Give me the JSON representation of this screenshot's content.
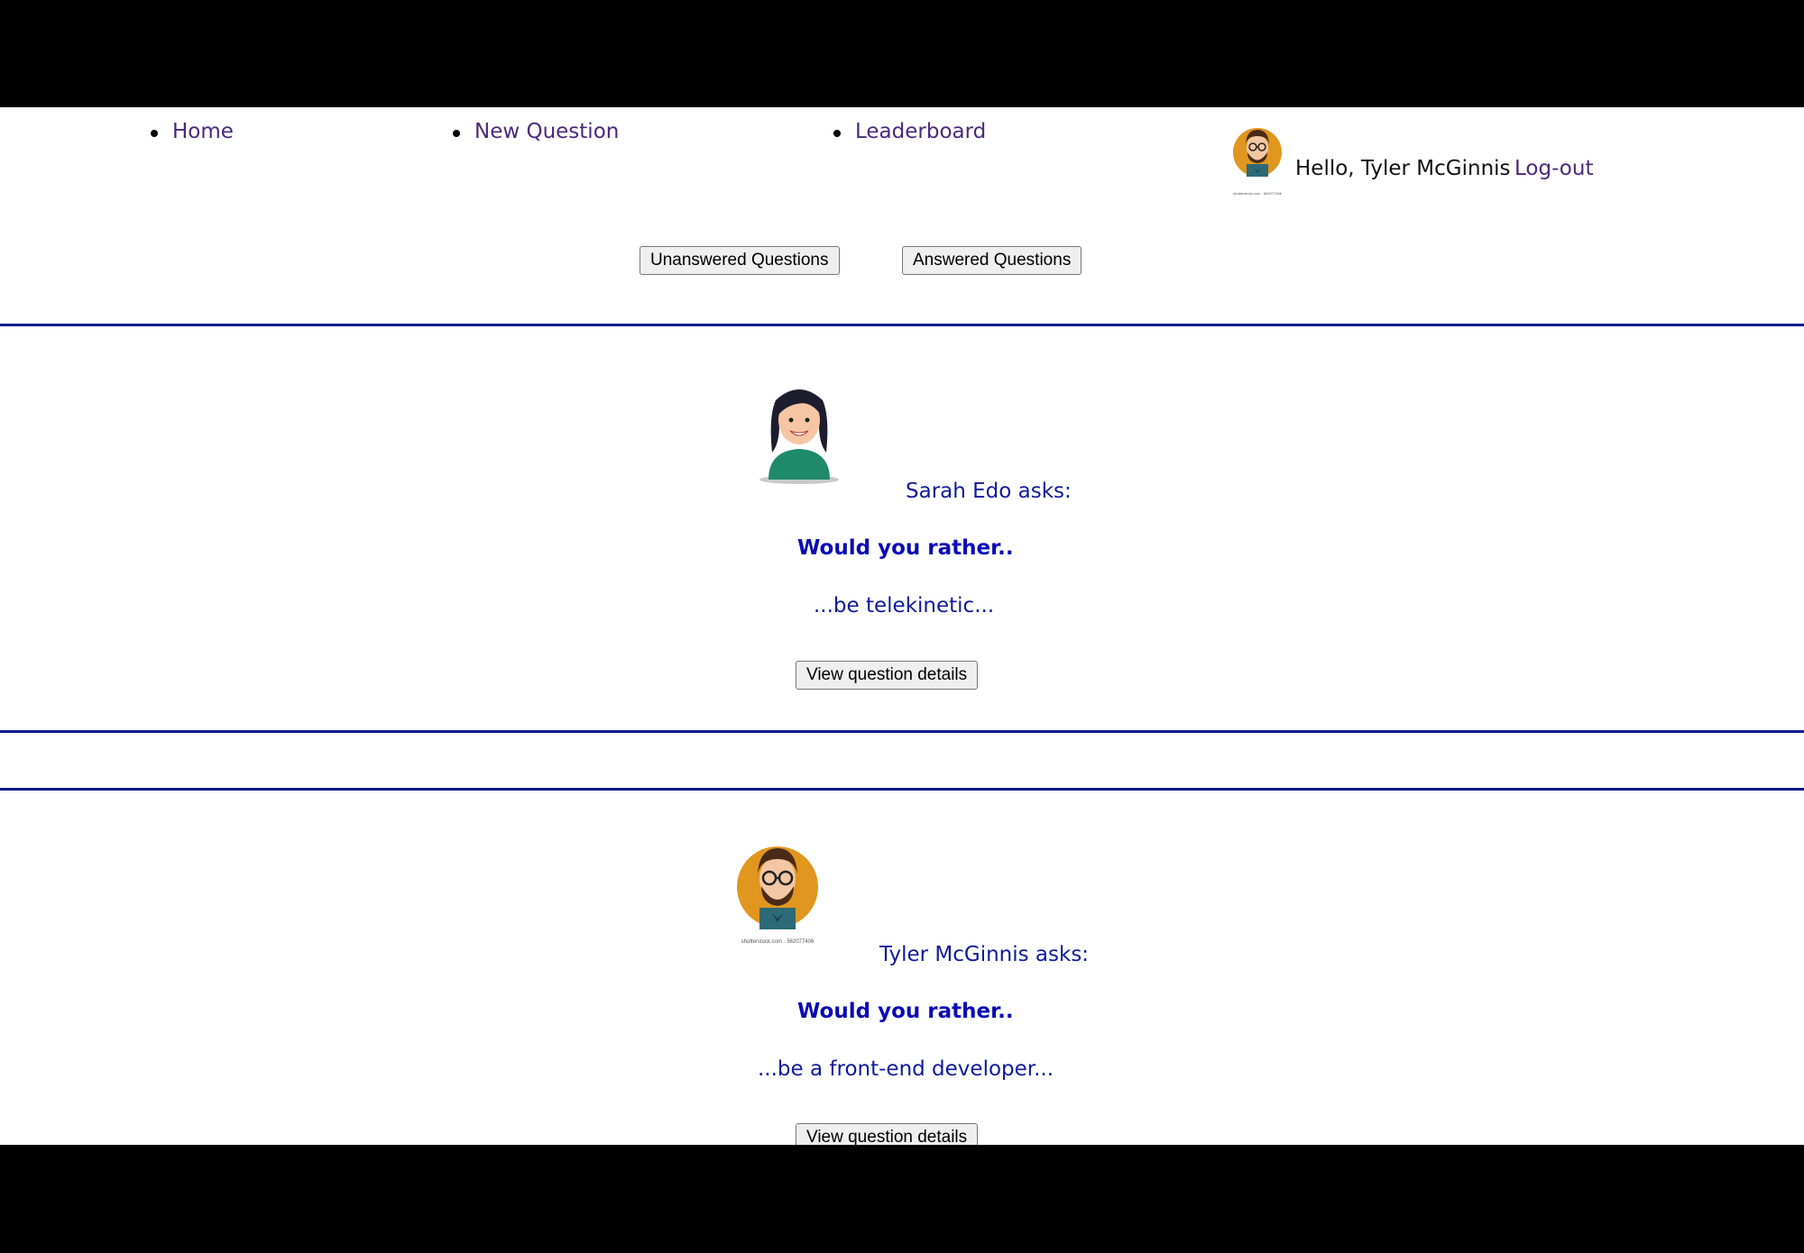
{
  "nav": {
    "items": [
      {
        "label": "Home"
      },
      {
        "label": "New Question"
      },
      {
        "label": "Leaderboard"
      }
    ],
    "greeting": "Hello, Tyler McGinnis",
    "logout_label": "Log-out",
    "user_avatar_caption": "shutterstock.com · 562077406"
  },
  "tabs": {
    "unanswered_label": "Unanswered Questions",
    "answered_label": "Answered Questions"
  },
  "questions": [
    {
      "asker": "Sarah Edo asks:",
      "prompt": "Would you rather..",
      "option_preview": "...be telekinetic...",
      "button_label": "View question details"
    },
    {
      "asker": "Tyler McGinnis asks:",
      "prompt": "Would you rather..",
      "option_preview": "...be a front-end developer...",
      "button_label": "View question details",
      "avatar_caption": "shutterstock.com · 562077406"
    }
  ],
  "colors": {
    "link": "#4b2a7c",
    "question_text": "#0e1a9e",
    "divider": "#0d1a8f"
  }
}
